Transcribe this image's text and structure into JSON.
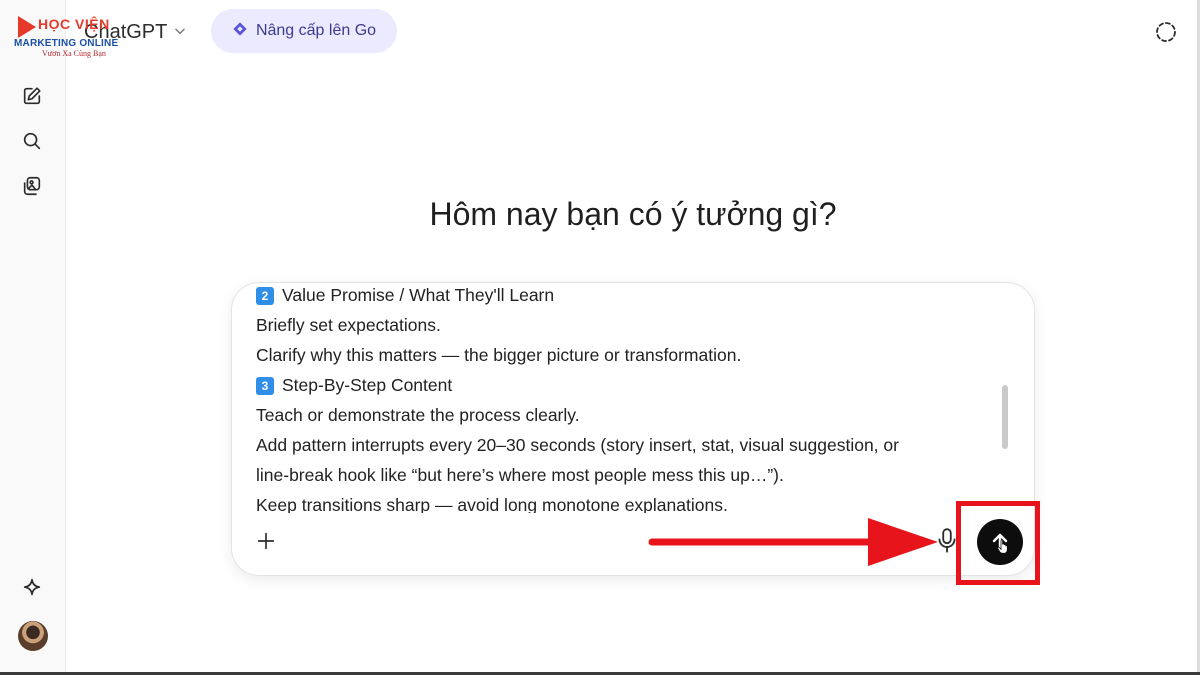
{
  "logo": {
    "top_text": "HỌC VIỆN",
    "mid_text": "MARKETING ONLINE",
    "sub_text": "Vươn Xa Cùng Bạn"
  },
  "header": {
    "model_name": "ChatGPT",
    "upgrade_label": "Nâng cấp lên Go"
  },
  "sidebar": {
    "items": [
      {
        "icon": "new-chat-icon"
      },
      {
        "icon": "search-icon"
      },
      {
        "icon": "library-icon"
      },
      {
        "icon": "sparkle-icon"
      }
    ]
  },
  "main": {
    "heading": "Hôm nay bạn có ý tưởng gì?"
  },
  "composer": {
    "badge_2": "2",
    "badge_3": "3",
    "lines": [
      "Value Promise / What They'll Learn",
      "Briefly set expectations.",
      "Clarify why this matters — the bigger picture or transformation.",
      "Step-By-Step Content",
      "Teach or demonstrate the process clearly.",
      "Add pattern interrupts every 20–30 seconds (story insert, stat, visual suggestion, or",
      "line-break hook like “but here’s where most people mess this up…”).",
      "Keep transitions sharp — avoid long monotone explanations."
    ]
  },
  "colors": {
    "accent": "#e8141c",
    "upgrade_bg": "#eceaff",
    "send_bg": "#0d0d0d"
  }
}
